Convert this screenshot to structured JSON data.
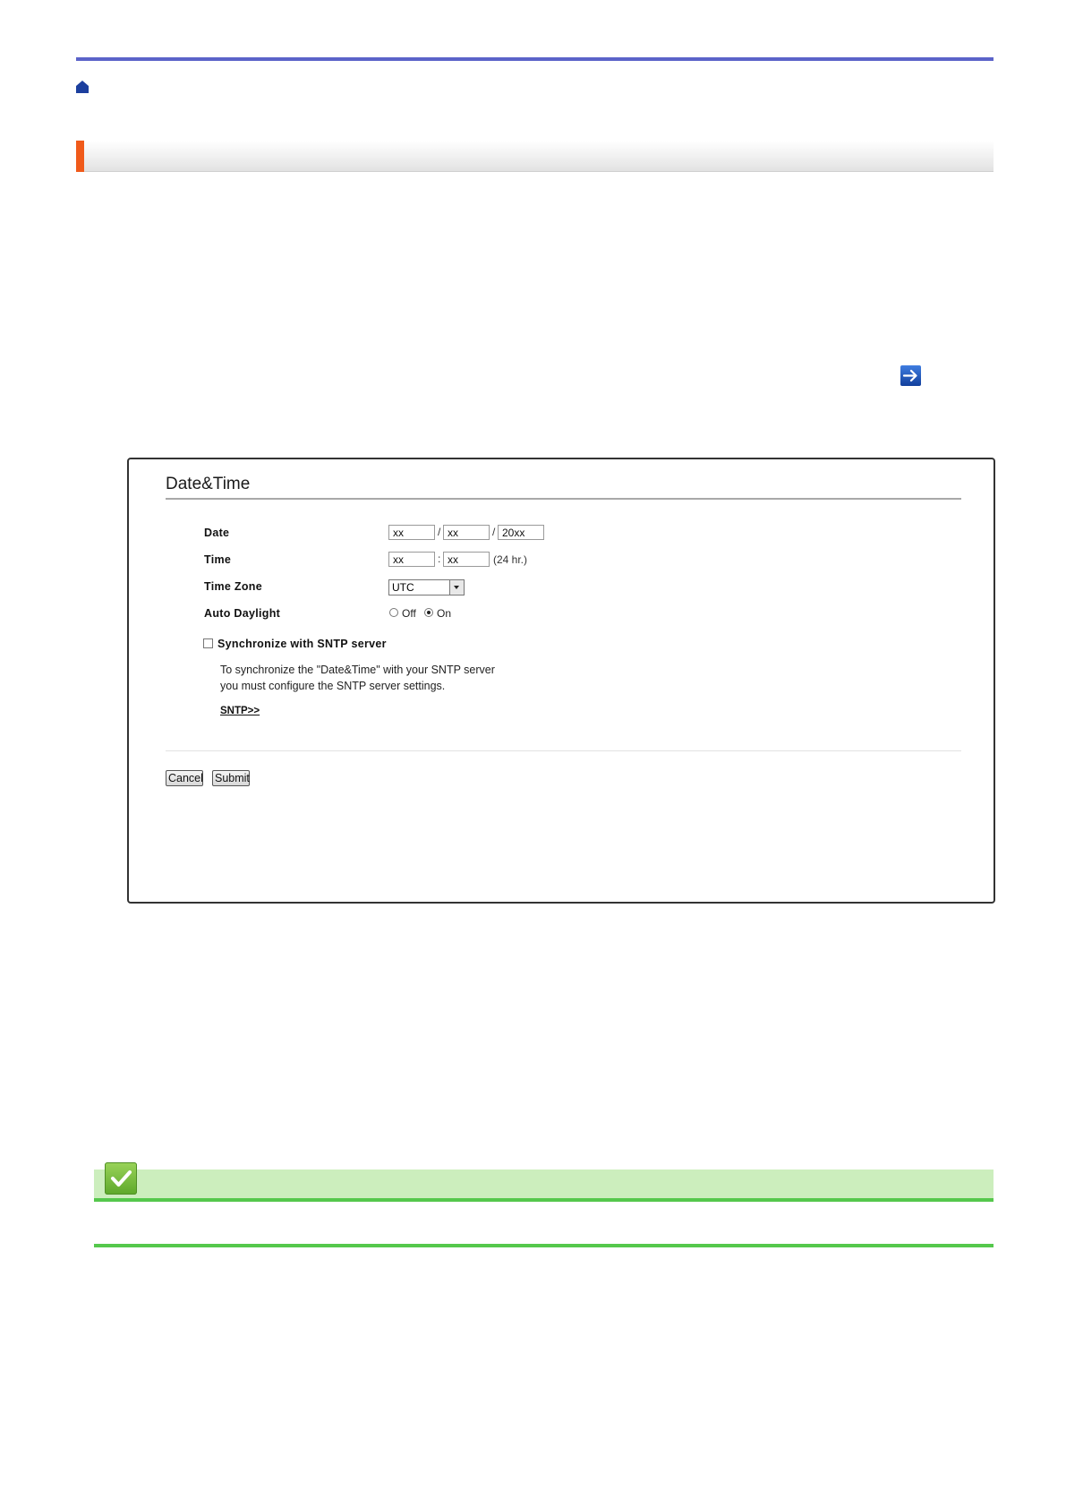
{
  "icons": {
    "home": "home-icon",
    "arrow": "arrow-right-icon",
    "check": "check-icon"
  },
  "colors": {
    "top_rule": "#5b63c9",
    "heading_accent": "#f05a1a",
    "note_band": "#cceebd",
    "note_line": "#55c84c",
    "arrow_icon": "#1f56c4"
  },
  "screenshot": {
    "title": "Date&Time",
    "date": {
      "label": "Date",
      "month": "xx",
      "day": "xx",
      "year": "20xx",
      "separator": "/"
    },
    "time": {
      "label": "Time",
      "hour": "xx",
      "minute": "xx",
      "separator": ":",
      "suffix": "(24 hr.)"
    },
    "time_zone": {
      "label": "Time Zone",
      "value": "UTC"
    },
    "auto_daylight": {
      "label": "Auto Daylight",
      "off_label": "Off",
      "on_label": "On",
      "selected": "On"
    },
    "sync": {
      "label": "Synchronize with SNTP server",
      "checked": false,
      "note_line1": "To synchronize the \"Date&Time\" with your SNTP server",
      "note_line2": "you must configure the SNTP server settings.",
      "link": "SNTP>>"
    },
    "buttons": {
      "cancel": "Cancel",
      "submit": "Submit"
    }
  }
}
